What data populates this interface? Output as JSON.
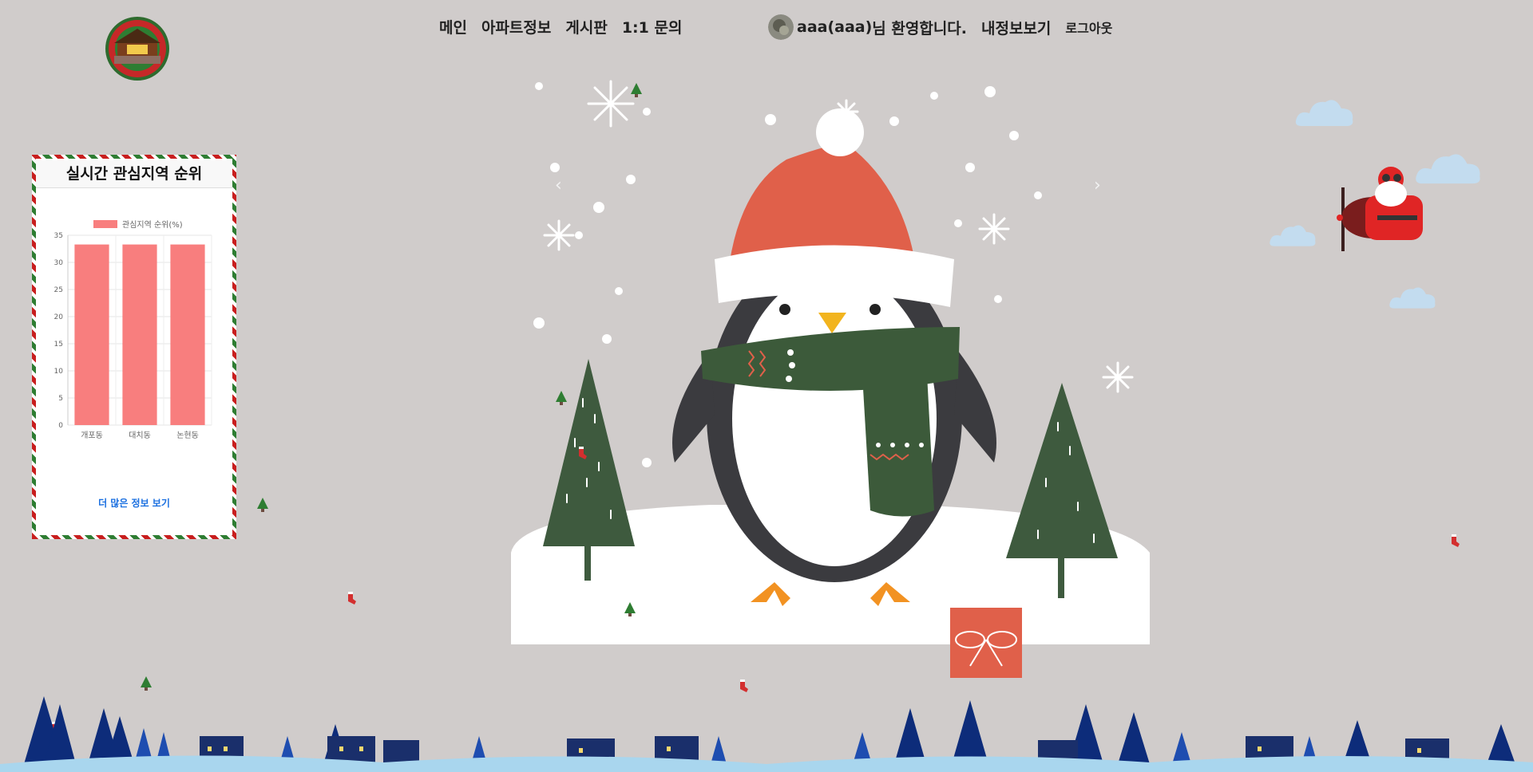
{
  "header": {
    "logo_icon": "where-is-my-home-logo",
    "nav": [
      "메인",
      "아파트정보",
      "게시판",
      "1:1 문의"
    ],
    "user_id": "aaa(aaa)",
    "welcome_suffix": "님 환영합니다.",
    "mypage_label": "내정보보기",
    "logout_label": "로그아웃"
  },
  "ranking_panel": {
    "title": "실시간 관심지역 순위",
    "more_label": "더 많은 정보 보기"
  },
  "chart_data": {
    "type": "bar",
    "categories": [
      "개포동",
      "대치동",
      "논현동"
    ],
    "series": [
      {
        "name": "관심지역 순위(%)",
        "values": [
          33.3,
          33.3,
          33.3
        ],
        "color": "#f87e7e"
      }
    ],
    "ylim": [
      0,
      35
    ],
    "yticks": [
      0,
      5,
      10,
      15,
      20,
      25,
      30,
      35
    ],
    "legend_position": "top"
  },
  "colors": {
    "background": "#d0cccb",
    "hat": "#e0604a",
    "scarf": "#3c5a3a",
    "tree": "#3e5a3e",
    "bar": "#f87e7e",
    "link": "#1a6fe0"
  }
}
